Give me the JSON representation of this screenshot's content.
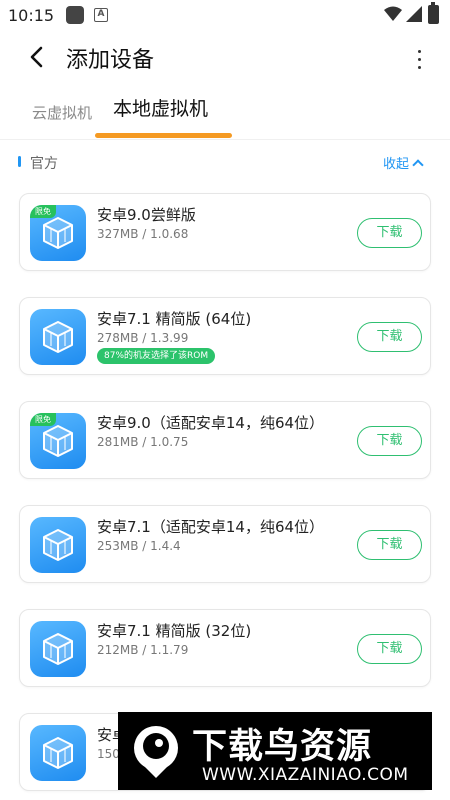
{
  "status_bar": {
    "time": "10:15",
    "icons": [
      "app-icon",
      "a-icon",
      "wifi-icon",
      "signal-icon",
      "battery-icon"
    ]
  },
  "app_bar": {
    "title": "添加设备",
    "back_icon": "chevron-left-icon",
    "more_icon": "more-vertical-icon"
  },
  "tabs": [
    {
      "label": "云虚拟机",
      "active": false
    },
    {
      "label": "本地虚拟机",
      "active": true
    }
  ],
  "accent_color": "#f59a23",
  "section": {
    "label": "官方",
    "collapse_label": "收起",
    "collapse_icon": "chevron-up-icon"
  },
  "cards": [
    {
      "name": "安卓9.0尝鲜版",
      "meta": "327MB / 1.0.68",
      "badge": "限免",
      "tag": "",
      "button": "下载"
    },
    {
      "name": "安卓7.1 精简版 (64位)",
      "meta": "278MB / 1.3.99",
      "badge": "",
      "tag": "87%的机友选择了该ROM",
      "button": "下载"
    },
    {
      "name": "安卓9.0（适配安卓14，纯64位）",
      "meta": "281MB / 1.0.75",
      "badge": "限免",
      "tag": "",
      "button": "下载"
    },
    {
      "name": "安卓7.1（适配安卓14，纯64位）",
      "meta": "253MB / 1.4.4",
      "badge": "",
      "tag": "",
      "button": "下载"
    },
    {
      "name": "安卓7.1 精简版 (32位)",
      "meta": "212MB / 1.1.79",
      "badge": "",
      "tag": "",
      "button": "下载"
    },
    {
      "name": "安卓",
      "meta": "150",
      "badge": "",
      "tag": "",
      "button": ""
    }
  ],
  "watermark": {
    "title": "下载鸟资源",
    "url": "WWW.XIAZAINIAO.COM"
  }
}
